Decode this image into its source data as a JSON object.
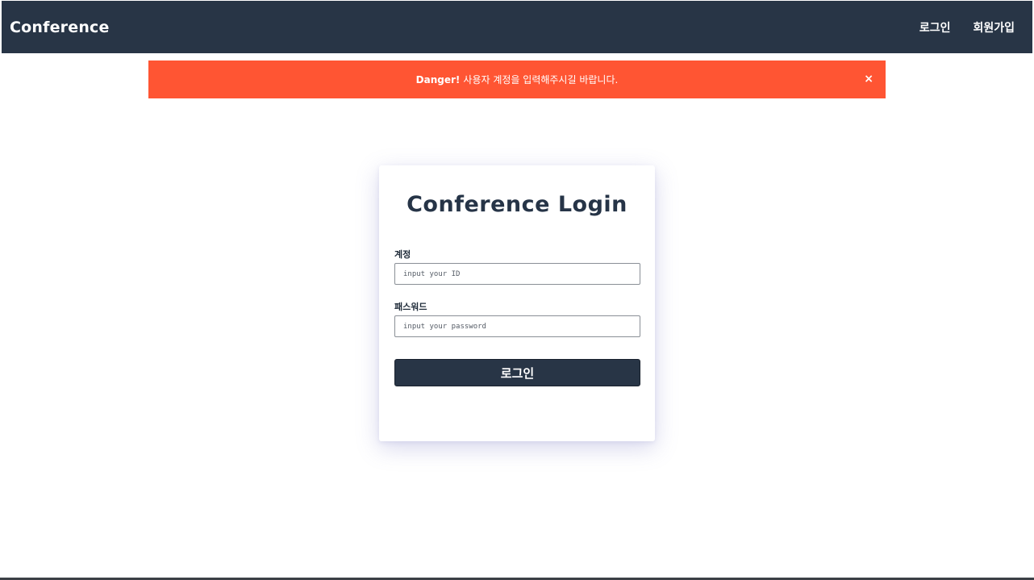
{
  "navbar": {
    "brand": "Conference",
    "links": {
      "login": "로그인",
      "signup": "회원가입"
    }
  },
  "alert": {
    "level": "Danger!",
    "message": "사용자 계정을 입력해주시길 바랍니다.",
    "close_symbol": "×",
    "color": "#ff5533"
  },
  "login_form": {
    "title": "Conference Login",
    "account_label": "계정",
    "account_placeholder": "input your ID",
    "account_value": "",
    "password_label": "패스워드",
    "password_placeholder": "input your password",
    "password_value": "",
    "submit_label": "로그인"
  },
  "colors": {
    "navbar": "#283546",
    "button": "#283546",
    "alert": "#ff5533"
  }
}
